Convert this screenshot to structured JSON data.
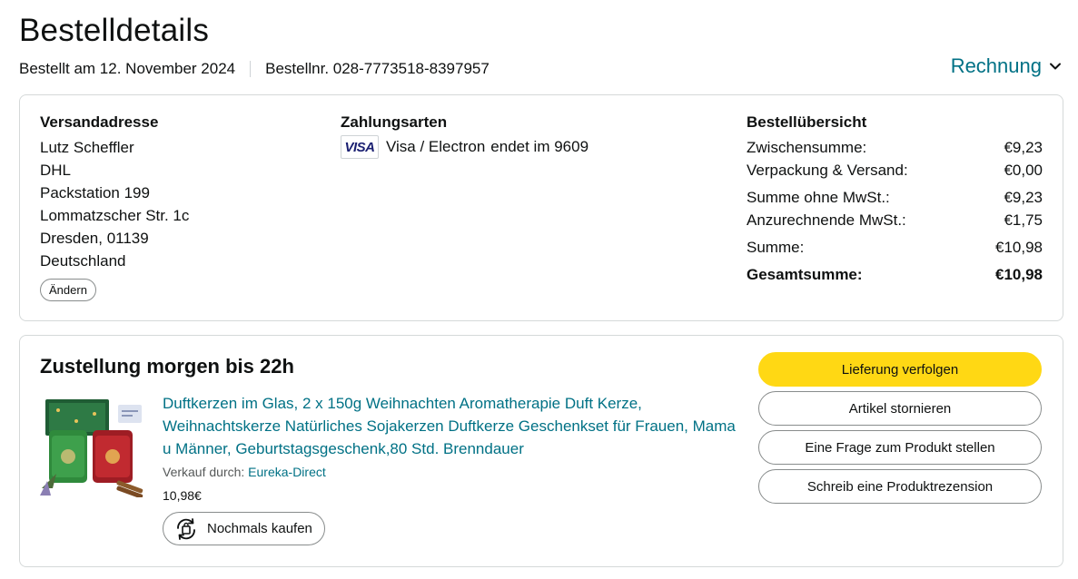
{
  "header": {
    "title": "Bestelldetails",
    "ordered": "Bestellt am 12. November 2024",
    "order_number": "Bestellnr. 028-7773518-8397957",
    "invoice_label": "Rechnung"
  },
  "shipping": {
    "title": "Versandadresse",
    "lines": [
      "Lutz Scheffler",
      "DHL",
      "Packstation 199",
      "Lommatzscher Str. 1c",
      "Dresden, 01139",
      "Deutschland"
    ],
    "change_label": "Ändern"
  },
  "payment": {
    "title": "Zahlungsarten",
    "card_brand": "VISA",
    "card_name": "Visa / Electron",
    "card_ending": "endet im 9609"
  },
  "summary": {
    "title": "Bestellübersicht",
    "rows": [
      {
        "label": "Zwischensumme:",
        "value": "€9,23"
      },
      {
        "label": "Verpackung & Versand:",
        "value": "€0,00"
      },
      {
        "label": "Summe ohne MwSt.:",
        "value": "€9,23"
      },
      {
        "label": "Anzurechnende MwSt.:",
        "value": "€1,75"
      },
      {
        "label": "Summe:",
        "value": "€10,98"
      }
    ],
    "total_label": "Gesamtsumme:",
    "total_value": "€10,98"
  },
  "delivery": {
    "title": "Zustellung morgen bis 22h",
    "product_title": "Duftkerzen im Glas, 2 x 150g Weihnachten Aromatherapie Duft Kerze, Weihnachtskerze Natürliches Sojakerzen Duftkerze Geschenkset für Frauen, Mama u Männer, Geburtstagsgeschenk,80 Std. Brenndauer",
    "seller_prefix": "Verkauf durch:",
    "seller_name": "Eureka-Direct",
    "price": "10,98€",
    "buy_again_label": "Nochmals kaufen",
    "actions": {
      "track": "Lieferung verfolgen",
      "cancel": "Artikel stornieren",
      "question": "Eine Frage zum Produkt stellen",
      "review": "Schreib eine Produktrezension"
    }
  },
  "colors": {
    "link": "#007185",
    "primary_button": "#ffd814",
    "border": "#d5d9d9"
  },
  "icons": {
    "invoice": "chevron-down-icon",
    "buy_again": "buy-again-icon"
  }
}
